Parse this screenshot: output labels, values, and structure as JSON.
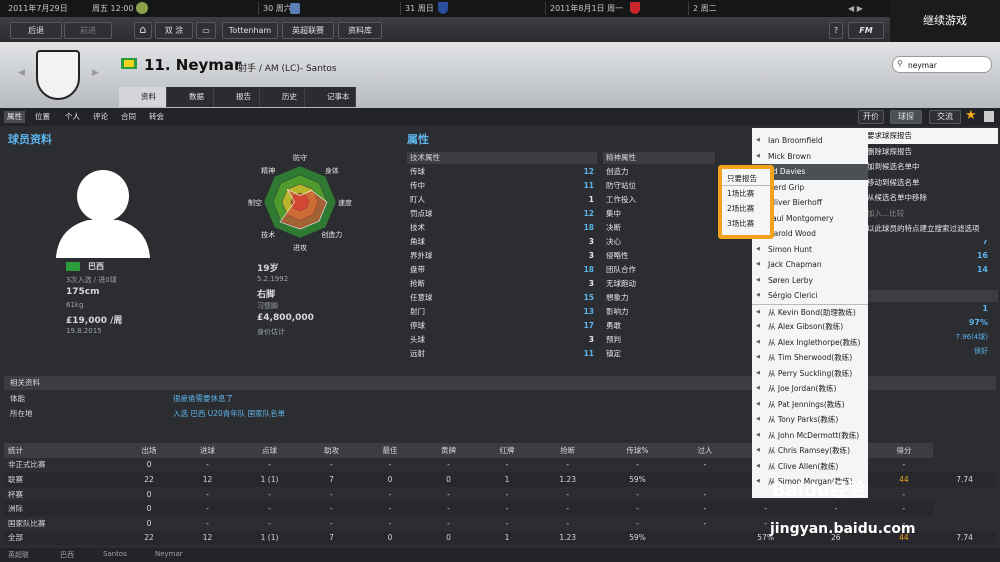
{
  "top": {
    "date": "2011年7月29日",
    "clock": "周五 12:00",
    "c2": "30 周六",
    "c3": "31 周日",
    "c4": "2011年8月1日 周一",
    "c5": "2 周二",
    "cont": "继续游戏"
  },
  "nav": {
    "back": "后退",
    "fwd": "前进",
    "shuang": "双 涂",
    "club": "Tottenham",
    "league": "英超联赛",
    "db": "资料库",
    "help": "?",
    "fm": "FM"
  },
  "player": {
    "name": "11. Neymar",
    "role": "射手 / AM (LC)- Santos",
    "search": "neymar"
  },
  "tabs": [
    "资料",
    "数据",
    "报告",
    "历史",
    "记事本"
  ],
  "sub": [
    "属性",
    "位置",
    "个人",
    "评论",
    "合同",
    "转会"
  ],
  "actions": {
    "offer": "开价",
    "scout": "球探",
    "comm": "交流"
  },
  "profile": {
    "title": "球员资料",
    "nation": "巴西",
    "caps": "3次入选 / 进0球",
    "height": "175cm",
    "weight": "61kg",
    "wage": "£19,000 /周",
    "wage_date": "19.8.2015",
    "age": "19岁",
    "dob": "5.2.1992",
    "foot": "右脚",
    "foot_l": "习惯脚",
    "value": "£4,800,000",
    "value_l": "身价估计"
  },
  "radar": {
    "labels": [
      "防守",
      "身体",
      "速度",
      "创造力",
      "进攻",
      "技术",
      "制空",
      "精神"
    ],
    "values": [
      0.18,
      0.45,
      0.75,
      0.75,
      0.75,
      0.78,
      0.15,
      0.5
    ]
  },
  "attr": {
    "title": "属性",
    "tech_h": "技术属性",
    "mental_h": "精神属性",
    "tech": [
      [
        "传球",
        "12"
      ],
      [
        "传中",
        "11"
      ],
      [
        "盯人",
        "1"
      ],
      [
        "罚点球",
        "12"
      ],
      [
        "技术",
        "18"
      ],
      [
        "角球",
        "3"
      ],
      [
        "界外球",
        "3"
      ],
      [
        "盘带",
        "18"
      ],
      [
        "抢断",
        "3"
      ],
      [
        "任意球",
        "15"
      ],
      [
        "射门",
        "13"
      ],
      [
        "停球",
        "17"
      ],
      [
        "头球",
        "3"
      ],
      [
        "远射",
        "11"
      ]
    ],
    "mental": [
      "创造力",
      "防守站位",
      "工作投入",
      "集中",
      "决断",
      "决心",
      "侵略性",
      "团队合作",
      "无球跑动",
      "想象力",
      "影响力",
      "勇敢",
      "预判",
      "镇定"
    ]
  },
  "right": {
    "r1": "7",
    "r2": "16",
    "r3": "14",
    "r4": "1",
    "r5": "97%",
    "r6": "7.96(4球)",
    "r7": "很好"
  },
  "related": {
    "title": "相关资料",
    "k1": "体能",
    "v1": "很疲倦需要休息了",
    "k2": "所在地",
    "v2": "入选 巴西 U20青年队 国家队名单"
  },
  "stats": {
    "head": [
      "统计",
      "出场",
      "进球",
      "点球",
      "助攻",
      "最佳",
      "黄牌",
      "红牌",
      "抢断",
      "传球%",
      "过人",
      "犯规",
      "被侵犯",
      "得分"
    ],
    "rows": [
      [
        "非正式比赛",
        "0",
        "-",
        "-",
        "-",
        "-",
        "-",
        "-",
        "-",
        "-",
        "-",
        "-",
        "-",
        "-"
      ],
      [
        "联赛",
        "22",
        "12",
        "1 (1)",
        "7",
        "0",
        "0",
        "1",
        "1.23",
        "59%",
        "",
        "57%",
        "26",
        "44",
        "7.74"
      ],
      [
        "杯赛",
        "0",
        "-",
        "-",
        "-",
        "-",
        "-",
        "-",
        "-",
        "-",
        "-",
        "-",
        "-",
        "-"
      ],
      [
        "洲际",
        "0",
        "-",
        "-",
        "-",
        "-",
        "-",
        "-",
        "-",
        "-",
        "-",
        "-",
        "-",
        "-"
      ],
      [
        "国家队比赛",
        "0",
        "-",
        "-",
        "-",
        "-",
        "-",
        "-",
        "-",
        "-",
        "-",
        "-",
        "-",
        "-"
      ],
      [
        "全部",
        "22",
        "12",
        "1 (1)",
        "7",
        "0",
        "0",
        "1",
        "1.23",
        "59%",
        "",
        "57%",
        "26",
        "44",
        "7.74"
      ]
    ]
  },
  "bottom": [
    "英超联",
    "巴西",
    "Santos",
    "Neymar"
  ],
  "scouts": [
    "Ian Broomfield",
    "Mick Brown",
    "Ed Davies",
    "Gerd Grip",
    "Oliver Bierhoff",
    "Paul Montgomery",
    "Harold Wood",
    "Simon Hunt",
    "Jack Chapman",
    "Søren Lerby",
    "Sérgio Clerici",
    "从 Kevin Bond(助理教练)",
    "从 Alex Gibson(教练)",
    "从 Alex Inglethorpe(教练)",
    "从 Tim Sherwood(教练)",
    "从 Perry Suckling(教练)",
    "从 Joe Jordan(教练)",
    "从 Pat Jennings(教练)",
    "从 Tony Parks(教练)",
    "从 John McDermott(教练)",
    "从 Chris Ramsey(教练)",
    "从 Clive Allen(教练)",
    "从 Simon Morgan(教练)"
  ],
  "reportmenu": [
    "只要报告",
    "1场比赛",
    "2场比赛",
    "3场比赛"
  ],
  "scoutmenu": [
    "要求球探报告",
    "删除球探报告",
    "加到候选名单中",
    "移动到候选名单",
    "从候选名单中移除",
    "加入...比较",
    "以此球员的特点建立搜索过滤选项"
  ],
  "watermark": {
    "brand": "Baidu经验",
    "url": "jingyan.baidu.com"
  }
}
